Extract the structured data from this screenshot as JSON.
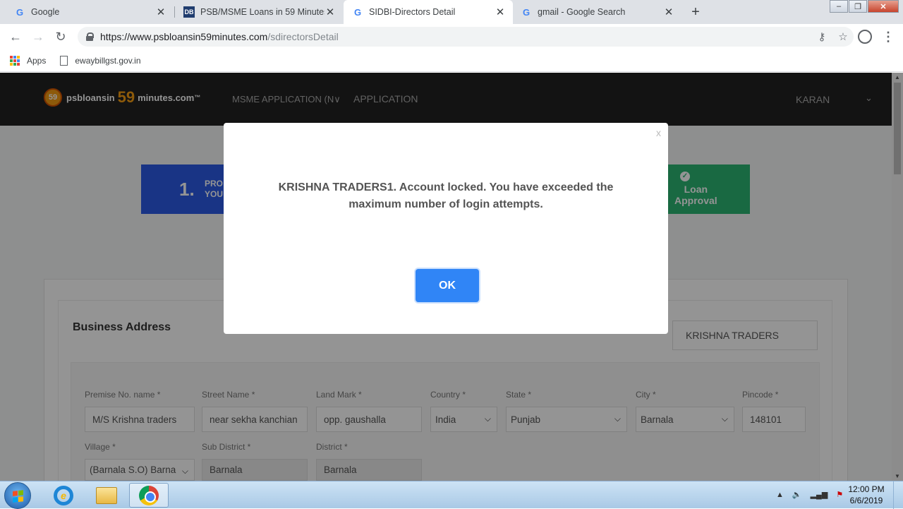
{
  "browser": {
    "tabs": [
      {
        "title": "Google",
        "favicon": "G",
        "active": false
      },
      {
        "title": "PSB/MSME Loans in 59 Minutes:",
        "favicon": "DB",
        "active": false
      },
      {
        "title": "SIDBI-Directors Detail",
        "favicon": "G",
        "active": true
      },
      {
        "title": "gmail - Google Search",
        "favicon": "G",
        "active": false
      }
    ],
    "url_host": "https://www.psbloansin59minutes.com",
    "url_path": "/sdirectorsDetail",
    "bookmarks": {
      "apps_label": "Apps",
      "item1": "ewaybillgst.gov.in"
    }
  },
  "site": {
    "logo_prefix": "psbloansin",
    "logo_number": "59",
    "logo_suffix": "minutes.com",
    "logo_tm": "™",
    "menu": [
      "MSME APPLICATION (N∨",
      "APPLICATION"
    ],
    "user": "KARAN",
    "step1_number": "1.",
    "step1_text_line1": "PRO",
    "step1_text_line2": "YOU",
    "step_final_line1": "Loan",
    "step_final_line2": "Approval",
    "business_address_title": "Business Address",
    "firm_name": "KRISHNA TRADERS",
    "fields": {
      "premise_label": "Premise No. name *",
      "premise_value": "M/S Krishna traders",
      "street_label": "Street Name *",
      "street_value": "near sekha kanchian",
      "landmark_label": "Land Mark *",
      "landmark_value": "opp. gaushalla",
      "country_label": "Country *",
      "country_value": "India",
      "state_label": "State *",
      "state_value": "Punjab",
      "city_label": "City *",
      "city_value": "Barnala",
      "pincode_label": "Pincode *",
      "pincode_value": "148101",
      "village_label": "Village *",
      "village_value": "(Barnala S.O) Barna",
      "subdistrict_label": "Sub District *",
      "subdistrict_value": "Barnala",
      "district_label": "District *",
      "district_value": "Barnala"
    }
  },
  "modal": {
    "close_label": "x",
    "message": "KRISHNA TRADERS1. Account locked. You have exceeded the maximum number of login attempts.",
    "ok_label": "OK"
  },
  "taskbar": {
    "time": "12:00 PM",
    "date": "6/6/2019"
  },
  "colors": {
    "accent_button": "#3085f6",
    "step_blue": "#2b5be6",
    "step_green": "#2bb673",
    "logo_orange": "#f39c12"
  }
}
